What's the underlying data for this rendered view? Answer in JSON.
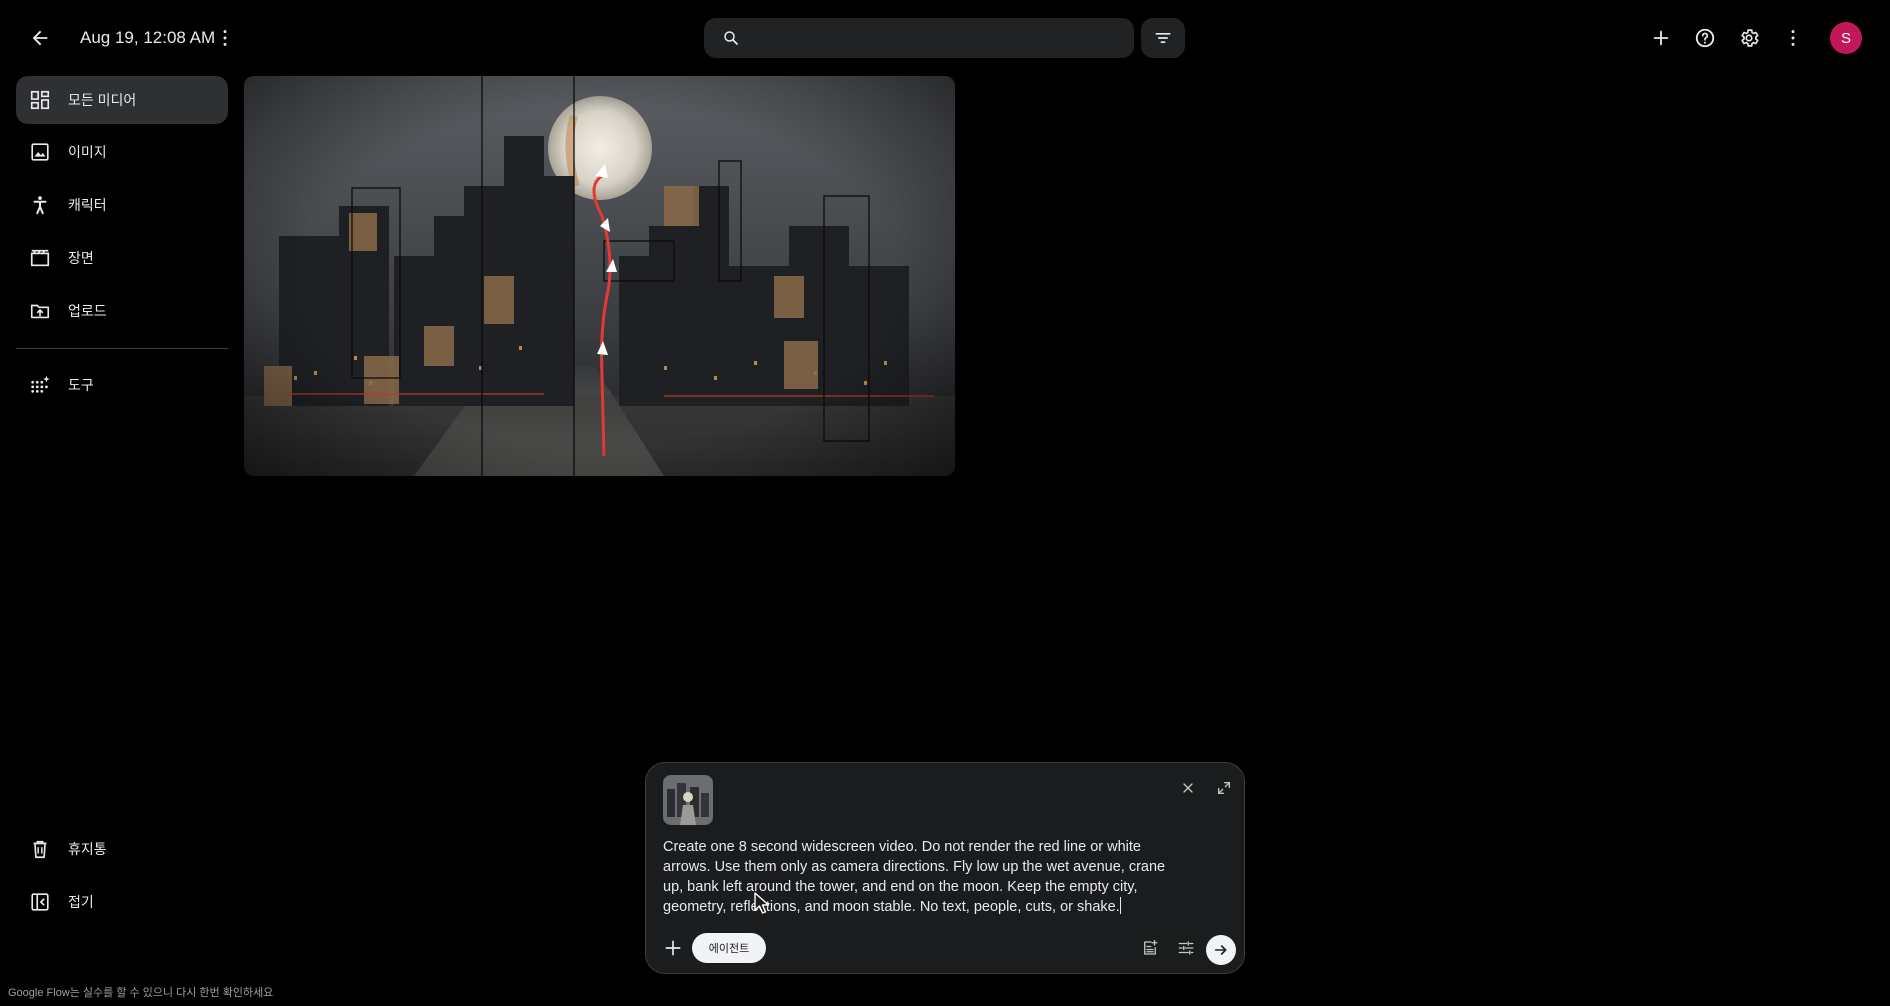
{
  "header": {
    "title": "Aug 19, 12:08 AM",
    "search_placeholder": "",
    "avatar_initial": "S"
  },
  "sidebar": {
    "items": [
      {
        "label": "모든 미디어",
        "icon": "grid-icon",
        "active": true
      },
      {
        "label": "이미지",
        "icon": "image-icon"
      },
      {
        "label": "캐릭터",
        "icon": "person-icon"
      },
      {
        "label": "장면",
        "icon": "movie-icon"
      },
      {
        "label": "업로드",
        "icon": "folder-upload-icon"
      },
      {
        "label": "도구",
        "icon": "tools-sparkle-icon"
      }
    ],
    "bottom_items": [
      {
        "label": "휴지통",
        "icon": "trash-icon"
      },
      {
        "label": "접기",
        "icon": "collapse-icon"
      }
    ]
  },
  "media": [
    {
      "type": "image",
      "description_icon": "city-moon-thumbnail"
    }
  ],
  "composer": {
    "prompt": "Create one 8 second widescreen video. Do not render the red line or white arrows. Use them only as camera directions. Fly low up the wet avenue, crane up, bank left around the tower, and end on the moon. Keep the empty city, geometry, reflections, and moon stable. No text, people, cuts, or shake.",
    "agent_label": "에이전트"
  },
  "footer": {
    "note": "Google Flow는 실수를 할 수 있으니 다시 한번 확인하세요"
  },
  "colors": {
    "background": "#000000",
    "surface": "#212224",
    "sidebar_active": "#2f3032",
    "avatar": "#c2185b"
  }
}
